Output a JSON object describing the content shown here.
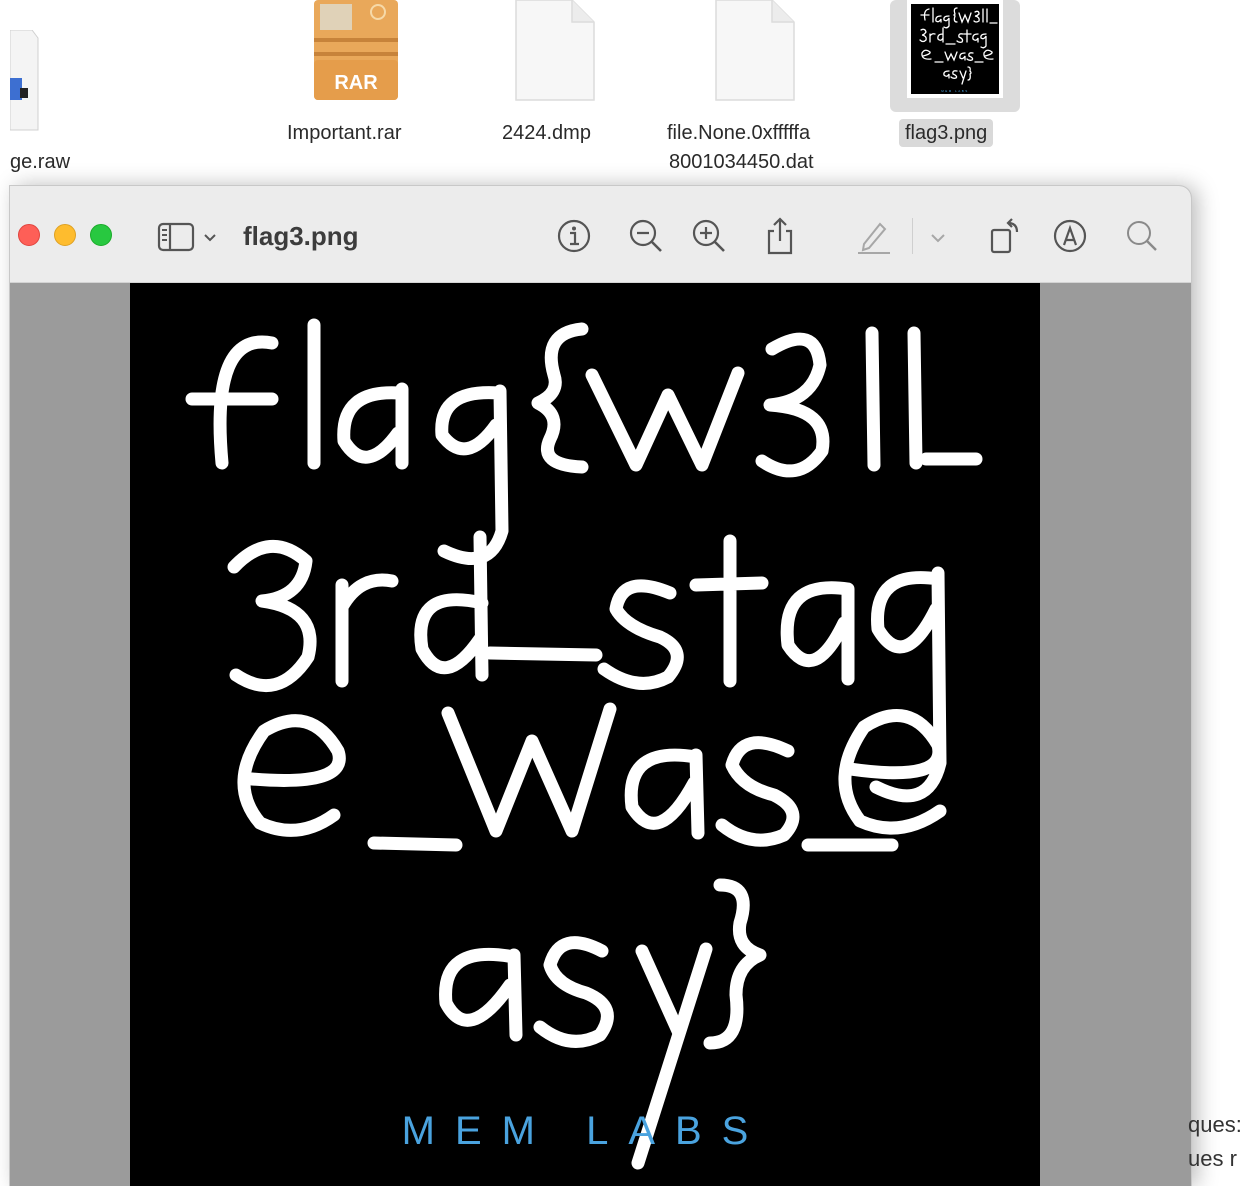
{
  "finder": {
    "files": [
      {
        "name": "ge.raw",
        "icon": "raw-disk-image-icon"
      },
      {
        "name": "Important.rar",
        "icon": "rar-archive-icon",
        "badge": "RAR"
      },
      {
        "name": "2424.dmp",
        "icon": "blank-document-icon"
      },
      {
        "name": "file.None.0xfffffa",
        "name_line2": "8001034450.dat",
        "icon": "blank-document-icon"
      },
      {
        "name": "flag3.png",
        "icon": "png-thumbnail-icon",
        "selected": true
      }
    ]
  },
  "preview": {
    "title": "flag3.png",
    "toolbar": [
      "sidebar-toggle-icon",
      "chevron-down-icon",
      "info-icon",
      "zoom-out-icon",
      "zoom-in-icon",
      "share-icon",
      "highlight-pen-icon",
      "chevron-down-icon",
      "rotate-icon",
      "markup-icon",
      "search-icon"
    ],
    "image": {
      "handwritten_lines": [
        "flag{w3ll_",
        "3rd_stag",
        "e_was_e",
        "asy}"
      ],
      "footer": "MEM LABS",
      "colors": {
        "background": "#000000",
        "text": "#ffffff",
        "footer": "#4aa3df"
      }
    }
  },
  "background_window": {
    "visible_text": [
      "ques:",
      "ues r"
    ]
  }
}
